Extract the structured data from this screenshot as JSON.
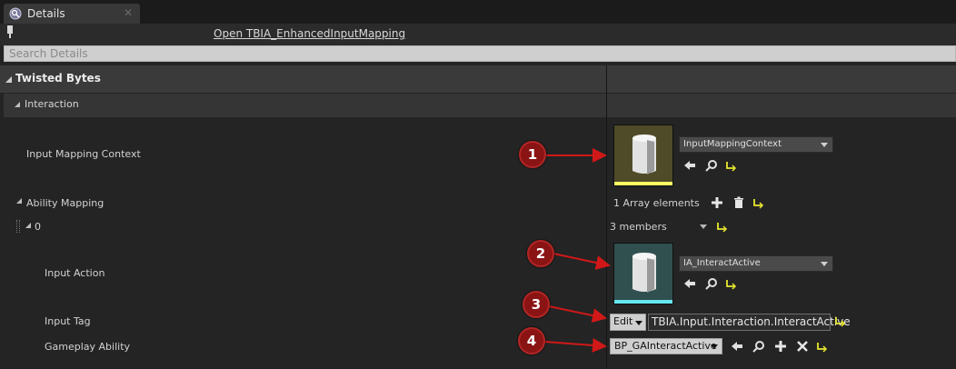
{
  "tab": {
    "title": "Details"
  },
  "header": {
    "open_link": "Open TBIA_EnhancedInputMapping"
  },
  "search": {
    "placeholder": "Search Details"
  },
  "category": {
    "title": "Twisted Bytes"
  },
  "subcategory": {
    "title": "Interaction"
  },
  "properties": {
    "input_mapping_context": {
      "label": "Input Mapping Context",
      "value": "InputMappingContext"
    },
    "ability_mapping": {
      "label": "Ability Mapping",
      "summary": "1 Array elements"
    },
    "element_0": {
      "label": "0",
      "summary": "3 members"
    },
    "input_action": {
      "label": "Input Action",
      "value": "IA_InteractActive"
    },
    "input_tag": {
      "label": "Input Tag",
      "edit_label": "Edit",
      "value": "TBIA.Input.Interaction.InteractActive"
    },
    "gameplay_ability": {
      "label": "Gameplay Ability",
      "value": "BP_GAInteractActive"
    }
  },
  "annotations": [
    "1",
    "2",
    "3",
    "4"
  ],
  "colors": {
    "annotation": "#8a1414",
    "arrow": "#d01818",
    "thumb_a_bar": "#ffff66",
    "thumb_b_bar": "#66e6f0"
  }
}
